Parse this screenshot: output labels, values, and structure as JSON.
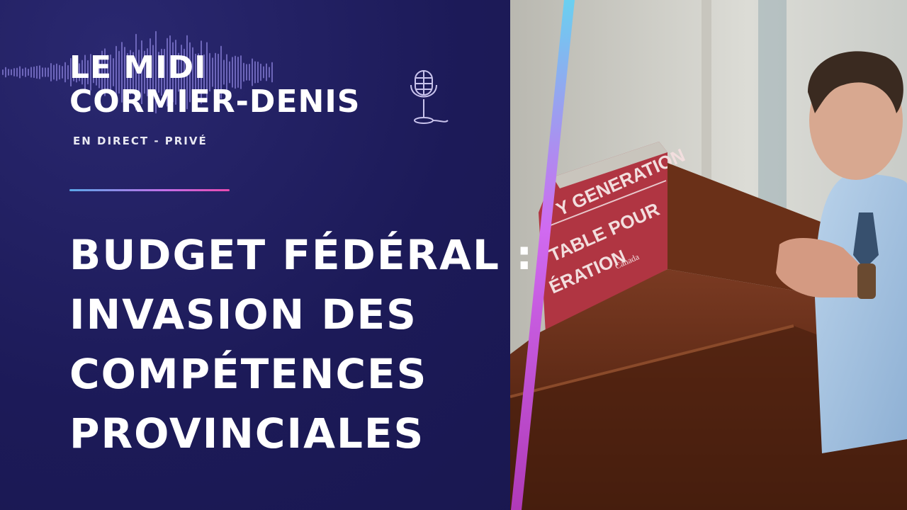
{
  "show": {
    "title_line1": "LE MIDI",
    "title_line2": "CORMIER-DENIS",
    "live_tag": "EN DIRECT - PRIVÉ"
  },
  "headline": {
    "line1": "BUDGET FÉDÉRAL :",
    "line2": "INVASION DES",
    "line3": "COMPÉTENCES",
    "line4": "PROVINCIALES"
  },
  "photo": {
    "sign_line1": "Y GENERATION",
    "sign_line2": "TABLE POUR",
    "sign_line3": "ÉRATION",
    "sign_logo": "Canada"
  },
  "colors": {
    "background": "#1c1a58",
    "accent_gradient_start": "#5aa8e8",
    "accent_gradient_end": "#e84ab0",
    "text": "#ffffff"
  },
  "icons": [
    "waveform-icon",
    "microphone-icon"
  ]
}
